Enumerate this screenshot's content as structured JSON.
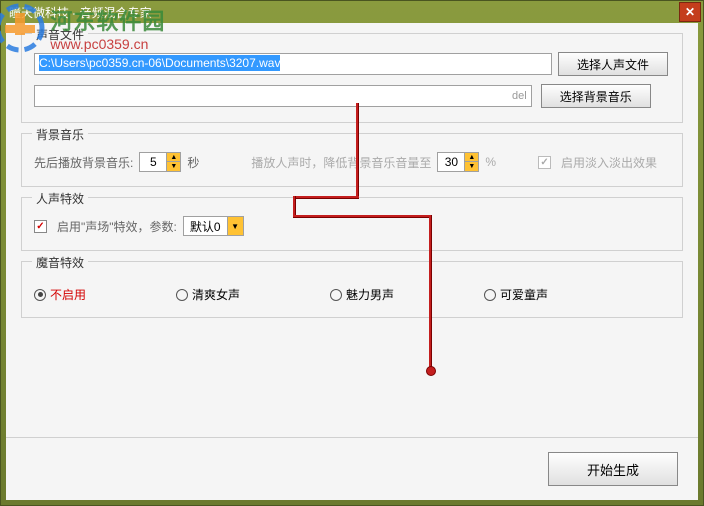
{
  "window": {
    "title": "瞳天微科技 - 音频混合专家"
  },
  "watermark": {
    "cn": "河东软件园",
    "url": "www.pc0359.cn"
  },
  "sections": {
    "voice_file": {
      "legend": "声音文件",
      "voice_path": "C:\\Users\\pc0359.cn-06\\Documents\\3207.wav",
      "bg_path": "",
      "del_hint": "del",
      "btn_voice": "选择人声文件",
      "btn_bg": "选择背景音乐"
    },
    "bg_music": {
      "legend": "背景音乐",
      "pre_label": "先后播放背景音乐:",
      "pre_seconds": "5",
      "sec_unit": "秒",
      "lower_label": "播放人声时，降低背景音乐音量至",
      "lower_value": "30",
      "lower_unit": "%",
      "fade_label": "启用淡入淡出效果"
    },
    "voice_fx": {
      "legend": "人声特效",
      "enable_label": "启用\"声场\"特效，参数:",
      "preset": "默认0"
    },
    "magic_fx": {
      "legend": "魔音特效",
      "options": {
        "none": "不启用",
        "female": "清爽女声",
        "male": "魅力男声",
        "child": "可爱童声"
      }
    }
  },
  "actions": {
    "generate": "开始生成"
  }
}
